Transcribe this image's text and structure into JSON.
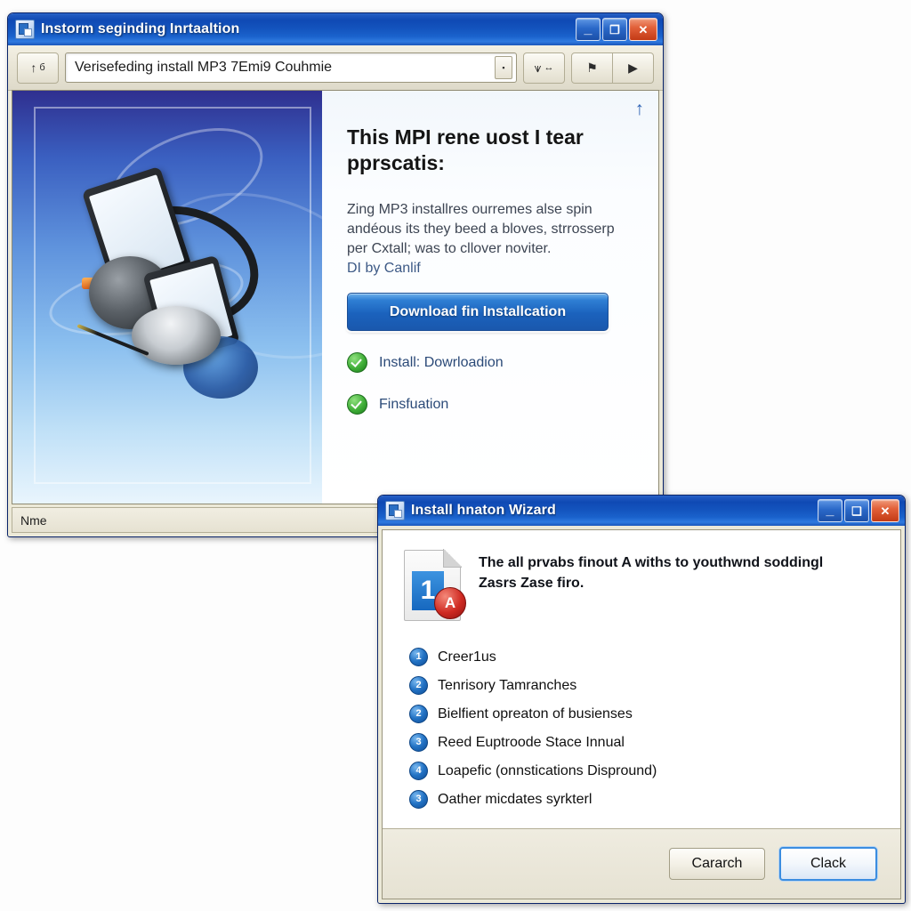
{
  "main_window": {
    "title": "Instorm seginding Inrtaaltion",
    "title_icon": "app-window-icon",
    "window_controls": {
      "minimize": "minimize-icon",
      "restore": "restore-icon",
      "close": "close-icon",
      "minimize_glyph": "_",
      "restore_glyph": "❐",
      "close_glyph": "✕"
    },
    "toolbar": {
      "up_button_glyph": "↑",
      "up_button_extra": "б",
      "address_value": "Verisefeding install MP3 7Emi9 Couhmie",
      "address_placeholder": "Verisefeding install MP3 7Emi9 Couhmie",
      "dropdown_glyph": "▪",
      "print_button_glyph": "⩛",
      "print_button_extra": "↔",
      "stop_button_glyph": "⚑",
      "play_button_glyph": "▶"
    },
    "banner": {
      "alt": "media-device-illustration"
    },
    "pane": {
      "scroll_up_glyph": "↑",
      "heading": "This MPI rene uost I tear pprscatis:",
      "body": "Zing MP3 installres ourremes alse spin andéous its they beed a bloves, strrosserp per Cxtall; was to cllover noviter.",
      "sub": "DI by Canlif",
      "cta_label": "Download fin Installcation",
      "checklist": [
        {
          "label": "Install: Dowrloadion",
          "icon": "check-circle-icon"
        },
        {
          "label": "Finsfuation",
          "icon": "check-circle-icon"
        }
      ]
    },
    "statusbar": {
      "text": "Nme"
    }
  },
  "dialog_window": {
    "title": "Install hnaton Wizard",
    "title_icon": "app-window-icon",
    "window_controls": {
      "minimize": "minimize-icon",
      "restore": "restore-icon",
      "close": "close-icon",
      "minimize_glyph": "_",
      "restore_glyph": "❑",
      "close_glyph": "✕"
    },
    "doc_icon": {
      "number": "1",
      "badge": "A"
    },
    "message": "The all prvabs finout A withs to youthwnd soddingl Zasrs Zase firo.",
    "steps": [
      {
        "num": "1",
        "label": "Creer1us"
      },
      {
        "num": "2",
        "label": "Tenrisory Tamranches"
      },
      {
        "num": "2",
        "label": "Bielfient opreaton of busienses"
      },
      {
        "num": "3",
        "label": "Reed Euptroode Stace Innual"
      },
      {
        "num": "4",
        "label": "Loapefic (onnstications Dispround)"
      },
      {
        "num": "3",
        "label": "Oather micdates syrkterl"
      }
    ],
    "buttons": {
      "secondary": "Cararch",
      "primary": "Clack"
    }
  },
  "colors": {
    "title_blue": "#1455bf",
    "accent_blue": "#2272c4",
    "cta_blue": "#1b62bd",
    "check_green": "#3fae37",
    "badge_red": "#cf2a22",
    "chrome_beige": "#ece9d8"
  }
}
